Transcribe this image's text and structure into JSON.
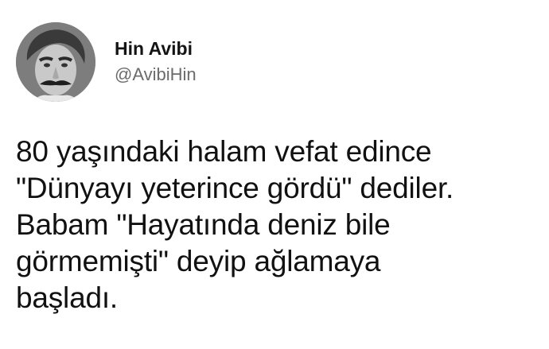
{
  "user": {
    "display_name": "Hin Avibi",
    "handle": "@AvibiHin",
    "avatar_icon": "profile-photo-mustached-man"
  },
  "tweet": {
    "lines": [
      "80 yaşındaki halam vefat edince",
      "\"Dünyayı yeterince gördü\" dediler.",
      "Babam \"Hayatında deniz bile",
      "görmemişti\" deyip ağlamaya",
      "başladı."
    ]
  }
}
